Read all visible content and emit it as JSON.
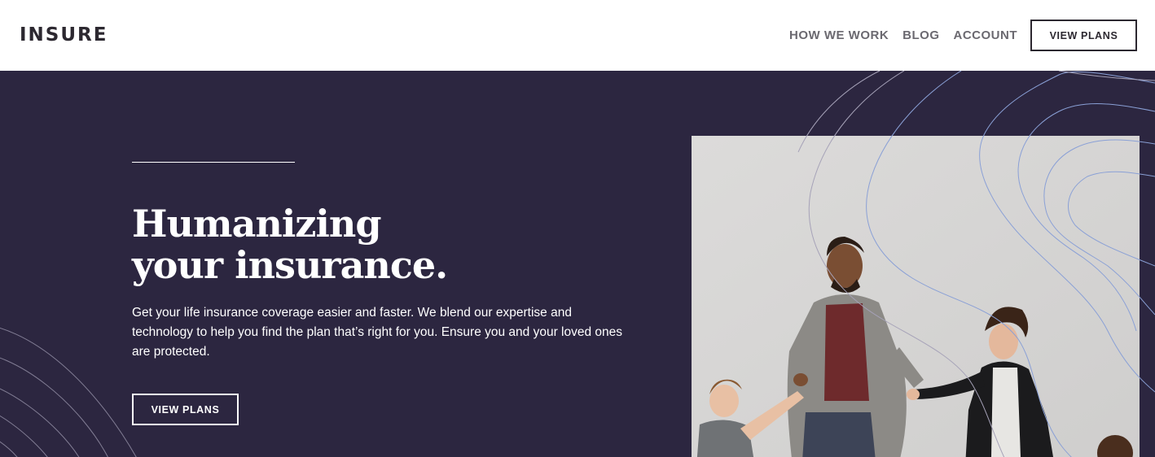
{
  "brand": {
    "logo": "INSURE"
  },
  "nav": {
    "links": [
      "HOW WE WORK",
      "BLOG",
      "ACCOUNT"
    ],
    "cta_label": "VIEW PLANS"
  },
  "hero": {
    "title_line1": "Humanizing",
    "title_line2": "your insurance.",
    "description": "Get your life insurance coverage easier and faster. We blend our expertise and technology to help you find the plan that’s right for you. Ensure you and your loved ones are protected.",
    "cta_label": "VIEW PLANS"
  },
  "colors": {
    "hero_bg": "#2c2640",
    "logo_text": "#2c2830",
    "nav_text": "#6b6970",
    "line_accent": "#8aa0d6"
  }
}
